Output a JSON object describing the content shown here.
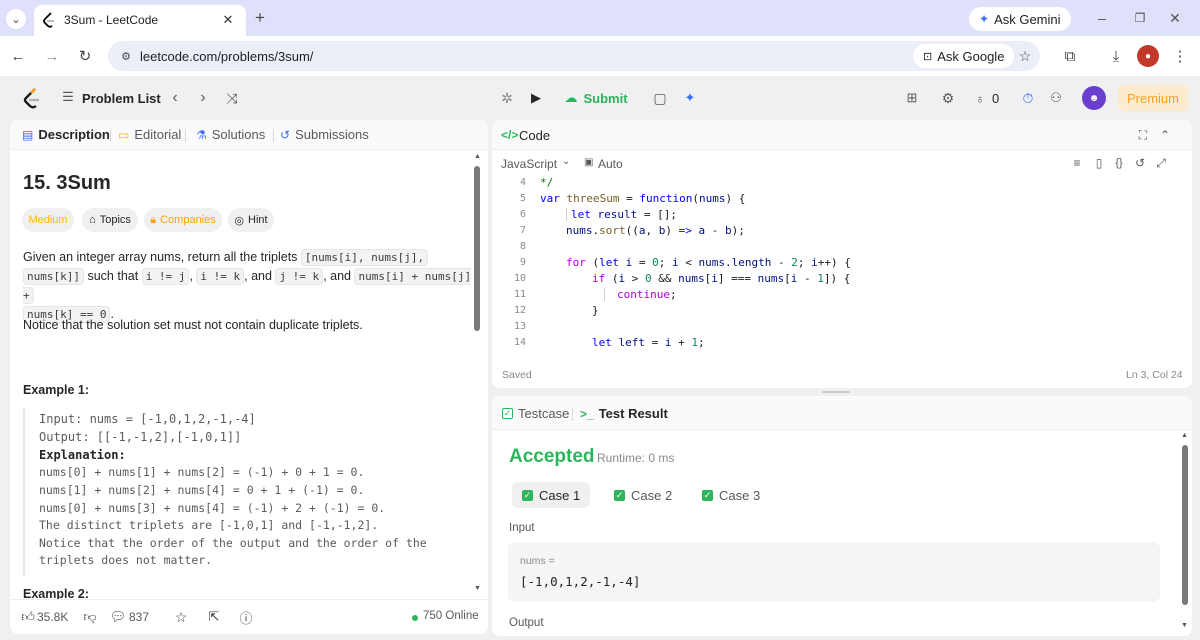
{
  "browser": {
    "tab_title": "3Sum - LeetCode",
    "url": "leetcode.com/problems/3sum/",
    "ask_gemini": "Ask Gemini",
    "ask_google": "Ask Google"
  },
  "nav": {
    "problem_list": "Problem List",
    "submit": "Submit",
    "streak": "0",
    "premium": "Premium"
  },
  "left_tabs": {
    "description": "Description",
    "editorial": "Editorial",
    "solutions": "Solutions",
    "submissions": "Submissions"
  },
  "problem": {
    "title": "15. 3Sum",
    "difficulty": "Medium",
    "topics": "Topics",
    "companies": "Companies",
    "hint": "Hint",
    "desc_1": "Given an integer array nums, return all the triplets",
    "desc_code_1": "[nums[i], nums[j],",
    "desc_code_2": "nums[k]]",
    "desc_2": "such that",
    "desc_code_3": "i != j",
    "desc_code_4": "i != k",
    "desc_3": ", and",
    "desc_code_5": "j != k",
    "desc_4": ", and",
    "desc_code_6": "nums[i] + nums[j] +",
    "desc_code_7": "nums[k] == 0",
    "note": "Notice that the solution set must not contain duplicate triplets.",
    "example1_title": "Example 1:",
    "example1_lines": [
      "Input: nums = [-1,0,1,2,-1,-4]",
      "Output: [[-1,-1,2],[-1,0,1]]",
      "Explanation:",
      "nums[0] + nums[1] + nums[2] = (-1) + 0 + 1 = 0.",
      "nums[1] + nums[2] + nums[4] = 0 + 1 + (-1) = 0.",
      "nums[0] + nums[3] + nums[4] = (-1) + 2 + (-1) = 0.",
      "The distinct triplets are [-1,0,1] and [-1,-1,2].",
      "Notice that the order of the output and the order of the",
      "triplets does not matter."
    ],
    "example2_title": "Example 2:"
  },
  "footer": {
    "likes": "35.8K",
    "comments": "837",
    "online": "750 Online"
  },
  "editor": {
    "title": "Code",
    "language": "JavaScript",
    "auto": "Auto",
    "saved": "Saved",
    "cursor": "Ln 3, Col 24",
    "line_numbers": [
      "4",
      "5",
      "6",
      "7",
      "8",
      "9",
      "10",
      "11",
      "12",
      "13",
      "14"
    ]
  },
  "result": {
    "testcase_tab": "Testcase",
    "result_tab": "Test Result",
    "status": "Accepted",
    "runtime": "Runtime: 0 ms",
    "cases": [
      "Case 1",
      "Case 2",
      "Case 3"
    ],
    "input_label": "Input",
    "param_name": "nums =",
    "param_value": "[-1,0,1,2,-1,-4]",
    "output_label": "Output"
  },
  "colors": {
    "accepted": "#2db55d",
    "medium": "#ffb800",
    "submit": "#2db55d",
    "premium": "#ffa116",
    "brand": "#ffa116"
  }
}
